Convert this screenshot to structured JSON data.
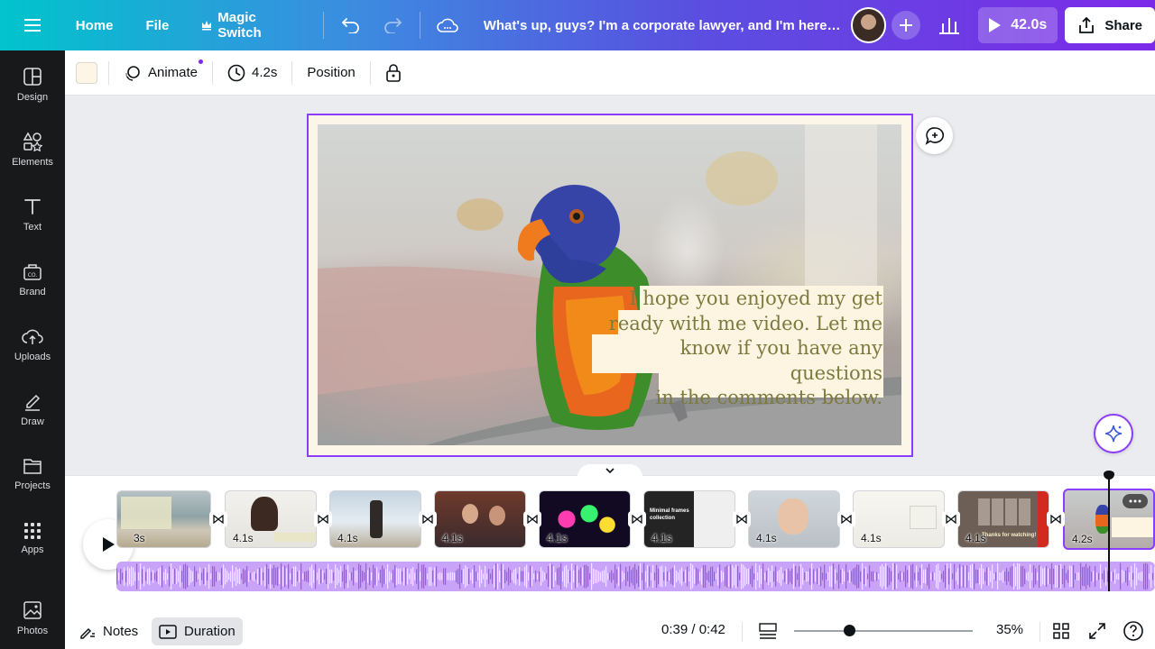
{
  "topbar": {
    "home_label": "Home",
    "file_label": "File",
    "magic_switch_label": "Magic Switch",
    "doc_title": "What's up, guys? I'm a corporate lawyer, and I'm here to ...",
    "play_duration": "42.0s",
    "share_label": "Share"
  },
  "sidebar": {
    "items": [
      {
        "label": "Design",
        "icon": "design-icon"
      },
      {
        "label": "Elements",
        "icon": "elements-icon"
      },
      {
        "label": "Text",
        "icon": "text-icon"
      },
      {
        "label": "Brand",
        "icon": "brand-icon"
      },
      {
        "label": "Uploads",
        "icon": "uploads-icon"
      },
      {
        "label": "Draw",
        "icon": "draw-icon"
      },
      {
        "label": "Projects",
        "icon": "projects-icon"
      },
      {
        "label": "Apps",
        "icon": "apps-icon"
      },
      {
        "label": "Photos",
        "icon": "photos-icon"
      }
    ]
  },
  "toolbar": {
    "swatch_color": "#fdf5e6",
    "animate_label": "Animate",
    "duration_label": "4.2s",
    "position_label": "Position"
  },
  "canvas": {
    "caption_lines": [
      "I hope you enjoyed my get",
      "ready with me video. Let me",
      "know if you have any questions",
      "in the comments below."
    ],
    "caption_color": "#7c7a3e",
    "frame_color": "#8b3dff"
  },
  "timeline": {
    "clips": [
      {
        "duration": "3s",
        "theme": "beach"
      },
      {
        "duration": "4.1s",
        "theme": "man-bald"
      },
      {
        "duration": "4.1s",
        "theme": "beach-man"
      },
      {
        "duration": "4.1s",
        "theme": "selfie"
      },
      {
        "duration": "4.1s",
        "theme": "neon"
      },
      {
        "duration": "4.1s",
        "theme": "minimal-frames"
      },
      {
        "duration": "4.1s",
        "theme": "child"
      },
      {
        "duration": "4.1s",
        "theme": "desk"
      },
      {
        "duration": "4.1s",
        "theme": "bathroom"
      },
      {
        "duration": "4.2s",
        "theme": "parrot"
      }
    ],
    "clip_texts": {
      "minimal_frames": "Minimal frames collection",
      "thanks": "Thanks for watching!"
    }
  },
  "footer": {
    "notes_label": "Notes",
    "duration_label": "Duration",
    "time_display": "0:39 / 0:42",
    "zoom_percent": "35%",
    "zoom_level": 0.35
  }
}
